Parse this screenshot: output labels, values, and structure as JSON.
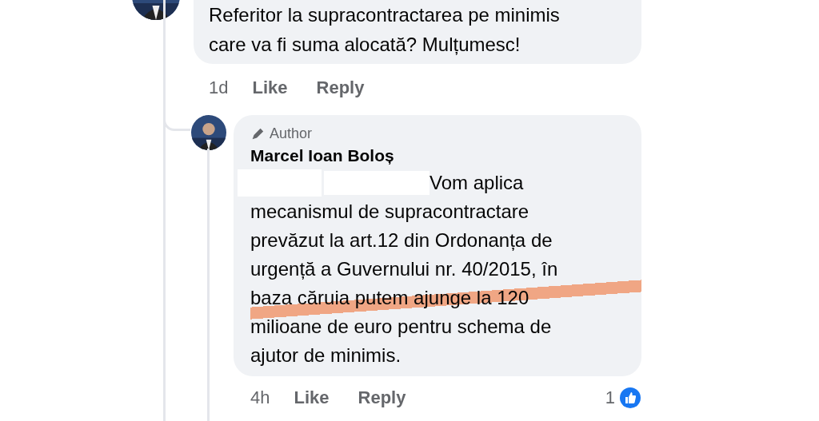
{
  "comment": {
    "text": "Referitor la supracontractarea pe minimis\ncare va fi suma alocată? Mulțumesc!",
    "time": "1d",
    "actions": [
      "Like",
      "Reply"
    ]
  },
  "reply": {
    "badge": "Author",
    "author": "Marcel Ioan Boloș",
    "text_lead": "Vom aplica",
    "text": "mecanismul de supracontractare\nprevăzut la art.12 din Ordonanța de\nurgență a Guvernului nr. 40/2015, în\nbaza căruia putem ajunge la 120\nmilioane de euro pentru schema de\najutor de minimis.",
    "time": "4h",
    "actions": [
      "Like",
      "Reply"
    ],
    "reaction_count": "1"
  }
}
